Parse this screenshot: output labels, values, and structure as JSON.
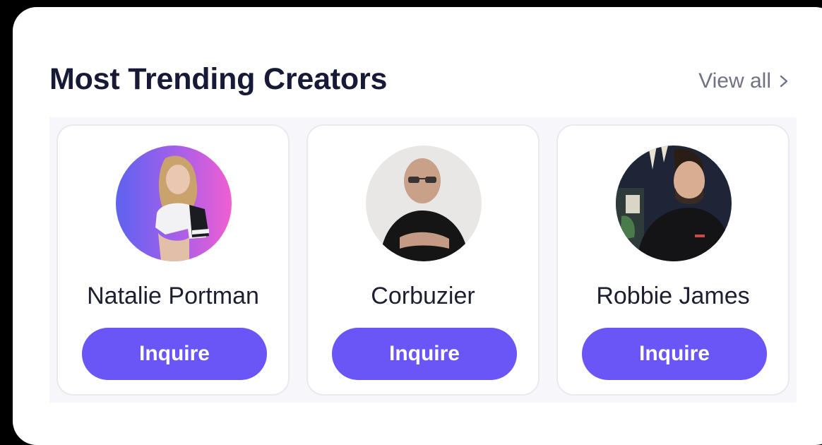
{
  "header": {
    "title": "Most Trending Creators",
    "view_all_label": "View all",
    "view_all_icon": "chevron-right-icon"
  },
  "creators": [
    {
      "name": "Natalie Portman",
      "button_label": "Inquire"
    },
    {
      "name": "Corbuzier",
      "button_label": "Inquire"
    },
    {
      "name": "Robbie James",
      "button_label": "Inquire"
    }
  ],
  "colors": {
    "page_bg": "#000000",
    "panel_bg": "#ffffff",
    "title": "#161a36",
    "muted": "#6f7283",
    "button": "#6a55f6",
    "button_text": "#ffffff",
    "card_border": "#e9e9ef"
  }
}
